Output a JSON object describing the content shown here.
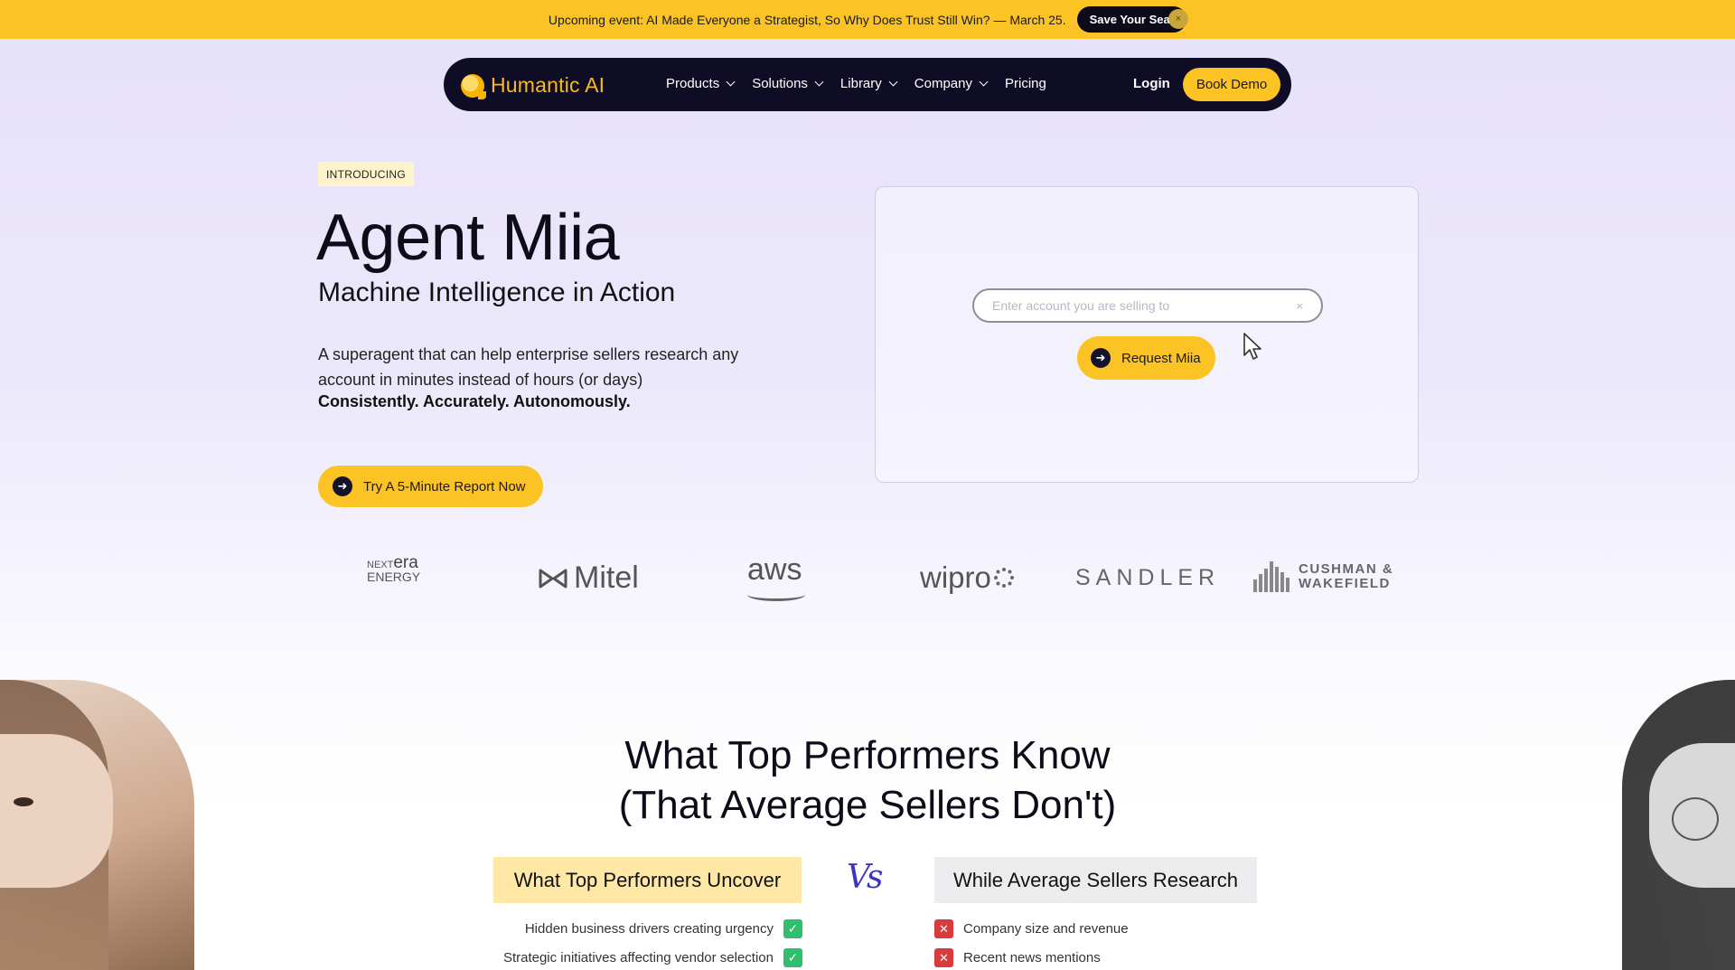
{
  "announcement": {
    "text": "Upcoming event: AI Made Everyone a Strategist, So Why Does Trust Still Win? — March 25.",
    "button_label": "Save Your Seat",
    "close_label": "×"
  },
  "nav": {
    "brand": "Humantic AI",
    "items": [
      {
        "label": "Products",
        "has_dropdown": true
      },
      {
        "label": "Solutions",
        "has_dropdown": true
      },
      {
        "label": "Library",
        "has_dropdown": true
      },
      {
        "label": "Company",
        "has_dropdown": true
      },
      {
        "label": "Pricing",
        "has_dropdown": false
      }
    ],
    "login_label": "Login",
    "cta_label": "Book Demo"
  },
  "hero": {
    "badge": "INTRODUCING",
    "title": "Agent Miia",
    "subtitle": "Machine Intelligence in Action",
    "description": "A superagent that can help enterprise sellers research any account in minutes instead of hours (or days)",
    "emphasis": "Consistently. Accurately. Autonomously.",
    "cta_label": "Try A 5-Minute Report Now"
  },
  "demo": {
    "search_placeholder": "Enter account you are selling to",
    "search_value": "",
    "clear_label": "×",
    "button_label": "Request Miia"
  },
  "logos": {
    "nextera_top": "NEXT",
    "nextera_era": "era",
    "nextera_bottom": "ENERGY",
    "mitel": "Mitel",
    "aws": "aws",
    "wipro": "wipro",
    "sandler": "SANDLER",
    "cushman_line1": "CUSHMAN &",
    "cushman_line2": "WAKEFIELD"
  },
  "comparison": {
    "title_line1": "What Top Performers Know",
    "title_line2": "(That Average Sellers Don't)",
    "left_heading": "What Top Performers Uncover",
    "vs": "Vs",
    "right_heading": "While Average Sellers Research",
    "left_items": [
      "Hidden business drivers creating urgency",
      "Strategic initiatives affecting vendor selection"
    ],
    "right_items": [
      "Company size and revenue",
      "Recent news mentions"
    ]
  },
  "colors": {
    "accent_yellow": "#fcc325",
    "nav_bg": "#0f0d26",
    "brand_text": "#f9b91d",
    "vs_blue": "#3c35c4",
    "check_green": "#2fbf6f",
    "x_red": "#d83b3b"
  },
  "icons": {
    "arrow": "arrow-right-circle-icon",
    "check": "check-box-icon",
    "cross": "x-box-icon",
    "chevron": "chevron-down-icon"
  }
}
